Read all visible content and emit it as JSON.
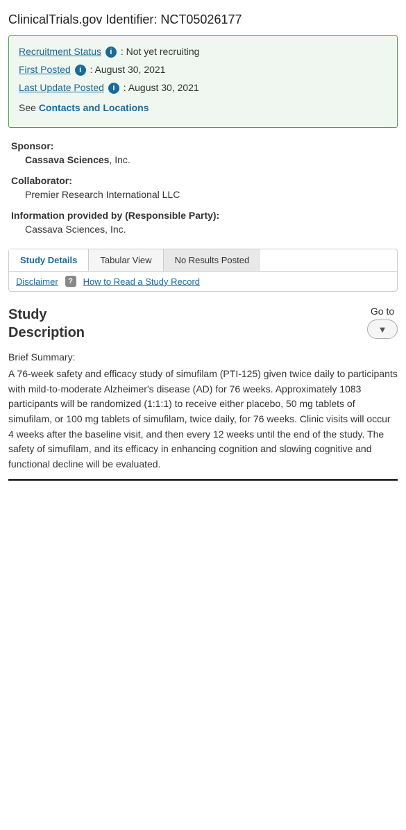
{
  "header": {
    "title": "ClinicalTrials.gov Identifier: NCT05026177"
  },
  "status_box": {
    "recruitment_label": "Recruitment Status",
    "recruitment_value": "Not yet recruiting",
    "first_posted_label": "First Posted",
    "first_posted_value": "August 30, 2021",
    "last_update_label": "Last Update Posted",
    "last_update_value": "August 30, 2021",
    "contacts_prefix": "See",
    "contacts_link": "Contacts and Locations"
  },
  "sponsor": {
    "label": "Sponsor:",
    "name": "Cassava Sciences",
    "suffix": ", Inc."
  },
  "collaborator": {
    "label": "Collaborator:",
    "name": "Premier Research International LLC"
  },
  "info_provided": {
    "label": "Information provided by (Responsible Party):",
    "value": "Cassava Sciences, Inc."
  },
  "tabs": {
    "study_details": "Study Details",
    "tabular_view": "Tabular View",
    "no_results_posted": "No Results Posted"
  },
  "sub_tabs": {
    "disclaimer": "Disclaimer",
    "help_label": "How to Read a Study Record"
  },
  "study_description": {
    "title_line1": "Study",
    "title_line2": "Description",
    "go_to_label": "Go to",
    "go_to_button": "▼",
    "brief_summary_label": "Brief Summary:",
    "brief_summary_text": "A 76-week safety and efficacy study of simufilam (PTI-125) given twice daily to participants with mild-to-moderate Alzheimer's disease (AD) for 76 weeks. Approximately 1083 participants will be randomized (1:1:1) to receive either placebo, 50 mg tablets of simufilam, or 100 mg tablets of simufilam, twice daily, for 76 weeks. Clinic visits will occur 4 weeks after the baseline visit, and then every 12 weeks until the end of the study. The safety of simufilam, and its efficacy in enhancing cognition and slowing cognitive and functional decline will be evaluated."
  }
}
